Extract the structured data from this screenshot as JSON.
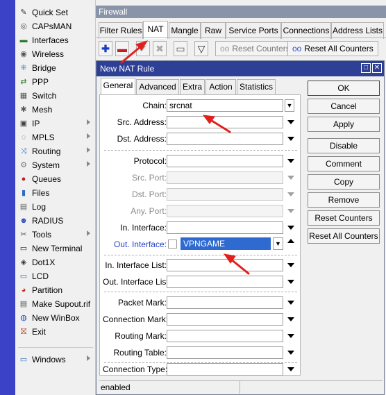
{
  "sidebar": {
    "items": [
      {
        "label": "Quick Set",
        "icon": "quickset-icon",
        "glyph": "✎",
        "color": "#333",
        "sub": false
      },
      {
        "label": "CAPsMAN",
        "icon": "capsman-icon",
        "glyph": "◎",
        "color": "#555",
        "sub": false
      },
      {
        "label": "Interfaces",
        "icon": "interfaces-icon",
        "glyph": "▬",
        "color": "#2a7a2a",
        "sub": false
      },
      {
        "label": "Wireless",
        "icon": "wireless-icon",
        "glyph": "◉",
        "color": "#555",
        "sub": false
      },
      {
        "label": "Bridge",
        "icon": "bridge-icon",
        "glyph": "⁜",
        "color": "#2a6cc0",
        "sub": false
      },
      {
        "label": "PPP",
        "icon": "ppp-icon",
        "glyph": "⇄",
        "color": "#2a7a2a",
        "sub": false
      },
      {
        "label": "Switch",
        "icon": "switch-icon",
        "glyph": "▦",
        "color": "#555",
        "sub": false
      },
      {
        "label": "Mesh",
        "icon": "mesh-icon",
        "glyph": "✱",
        "color": "#555",
        "sub": false
      },
      {
        "label": "IP",
        "icon": "ip-icon",
        "glyph": "▣",
        "color": "#444",
        "sub": true
      },
      {
        "label": "MPLS",
        "icon": "mpls-icon",
        "glyph": "◌",
        "color": "#555",
        "sub": true
      },
      {
        "label": "Routing",
        "icon": "routing-icon",
        "glyph": "⤨",
        "color": "#2a6cc0",
        "sub": true
      },
      {
        "label": "System",
        "icon": "system-icon",
        "glyph": "⚙",
        "color": "#777",
        "sub": true
      },
      {
        "label": "Queues",
        "icon": "queues-icon",
        "glyph": "●",
        "color": "#c02020",
        "sub": false
      },
      {
        "label": "Files",
        "icon": "files-icon",
        "glyph": "▮",
        "color": "#2a6cc0",
        "sub": false
      },
      {
        "label": "Log",
        "icon": "log-icon",
        "glyph": "▤",
        "color": "#666",
        "sub": false
      },
      {
        "label": "RADIUS",
        "icon": "radius-icon",
        "glyph": "☻",
        "color": "#2a4cc0",
        "sub": false
      },
      {
        "label": "Tools",
        "icon": "tools-icon",
        "glyph": "✂",
        "color": "#555",
        "sub": true
      },
      {
        "label": "New Terminal",
        "icon": "terminal-icon",
        "glyph": "▭",
        "color": "#222",
        "sub": false
      },
      {
        "label": "Dot1X",
        "icon": "dot1x-icon",
        "glyph": "◈",
        "color": "#333",
        "sub": false
      },
      {
        "label": "LCD",
        "icon": "lcd-icon",
        "glyph": "▭",
        "color": "#2a6cc0",
        "sub": false
      },
      {
        "label": "Partition",
        "icon": "partition-icon",
        "glyph": "◕",
        "color": "#c03020",
        "sub": false
      },
      {
        "label": "Make Supout.rif",
        "icon": "supout-icon",
        "glyph": "▤",
        "color": "#555",
        "sub": false
      },
      {
        "label": "New WinBox",
        "icon": "winbox-icon",
        "glyph": "◍",
        "color": "#2a4cc0",
        "sub": false
      },
      {
        "label": "Exit",
        "icon": "exit-icon",
        "glyph": "⛝",
        "color": "#b04020",
        "sub": false
      }
    ],
    "windows_label": "Windows"
  },
  "firewall": {
    "title": "Firewall",
    "tabs": [
      "Filter Rules",
      "NAT",
      "Mangle",
      "Raw",
      "Service Ports",
      "Connections",
      "Address Lists"
    ],
    "reset_counters": "Reset Counters",
    "reset_all_counters": "Reset All Counters"
  },
  "dialog": {
    "title": "New NAT Rule",
    "tabs": [
      "General",
      "Advanced",
      "Extra",
      "Action",
      "Statistics"
    ],
    "fields": {
      "chain_label": "Chain:",
      "chain_value": "srcnat",
      "src_address_label": "Src. Address:",
      "dst_address_label": "Dst. Address:",
      "protocol_label": "Protocol:",
      "src_port_label": "Src. Port:",
      "dst_port_label": "Dst. Port:",
      "any_port_label": "Any. Port:",
      "in_interface_label": "In. Interface:",
      "out_interface_label": "Out. Interface:",
      "out_interface_value": "VPNGAME",
      "in_interface_list_label": "In. Interface List:",
      "out_interface_list_label": "Out. Interface List:",
      "packet_mark_label": "Packet Mark:",
      "connection_mark_label": "Connection Mark:",
      "routing_mark_label": "Routing Mark:",
      "routing_table_label": "Routing Table:",
      "connection_type_label": "Connection Type:"
    },
    "buttons": [
      "OK",
      "Cancel",
      "Apply",
      "Disable",
      "Comment",
      "Copy",
      "Remove",
      "Reset Counters",
      "Reset All Counters"
    ],
    "status": "enabled"
  },
  "colors": {
    "strip": "#3c42c8",
    "dialog_title": "#2e3f96",
    "annotation_arrow": "#e0201c",
    "selected_value": "#2e6ad0"
  }
}
